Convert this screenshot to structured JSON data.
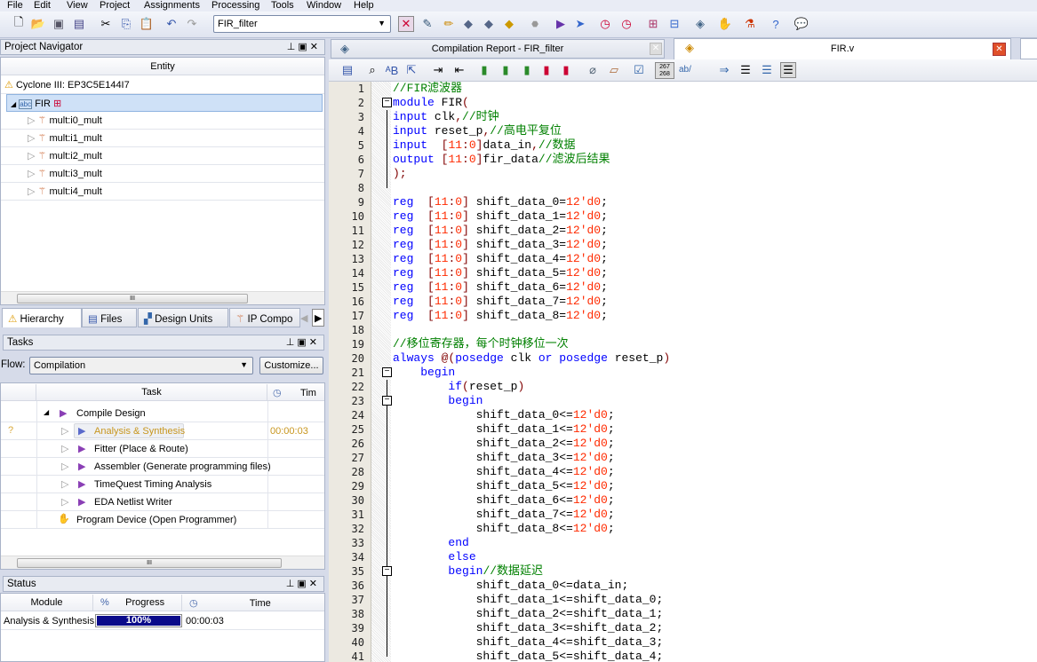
{
  "menu": [
    "File",
    "Edit",
    "View",
    "Project",
    "Assignments",
    "Processing",
    "Tools",
    "Window",
    "Help"
  ],
  "toolbar": {
    "project_combo": "FIR_filter"
  },
  "project_navigator": {
    "title": "Project Navigator",
    "column": "Entity",
    "device": "Cyclone III: EP3C5E144I7",
    "top_entity": "FIR",
    "children": [
      "mult:i0_mult",
      "mult:i1_mult",
      "mult:i2_mult",
      "mult:i3_mult",
      "mult:i4_mult"
    ],
    "tabs": [
      "Hierarchy",
      "Files",
      "Design Units",
      "IP Compo"
    ]
  },
  "tasks": {
    "title": "Tasks",
    "flow_label": "Flow:",
    "flow_value": "Compilation",
    "customize": "Customize...",
    "col_task": "Task",
    "col_time": "Tim",
    "items": [
      {
        "label": "Compile Design",
        "time": ""
      },
      {
        "label": "Analysis & Synthesis",
        "time": "00:00:03",
        "status": "?"
      },
      {
        "label": "Fitter (Place & Route)",
        "time": ""
      },
      {
        "label": "Assembler (Generate programming files)",
        "time": ""
      },
      {
        "label": "TimeQuest Timing Analysis",
        "time": ""
      },
      {
        "label": "EDA Netlist Writer",
        "time": ""
      },
      {
        "label": "Program Device (Open Programmer)",
        "time": ""
      }
    ]
  },
  "status": {
    "title": "Status",
    "col_module": "Module",
    "col_pct": "%",
    "col_progress": "Progress",
    "col_time": "Time",
    "row": {
      "module": "Analysis & Synthesis",
      "progress_text": "100%",
      "progress": 100,
      "time": "00:00:03"
    }
  },
  "editor": {
    "tabs": [
      "Compilation Report - FIR_filter",
      "FIR.v"
    ],
    "line_counter": [
      "267",
      "268"
    ],
    "toolbar_ab": "ab/",
    "lines": [
      [
        [
          "c",
          "//FIR滤波器"
        ]
      ],
      [
        [
          "k",
          "module"
        ],
        [
          "t",
          " FIR"
        ],
        [
          "p",
          "("
        ]
      ],
      [
        [
          "k",
          "input"
        ],
        [
          "t",
          " clk"
        ],
        [
          "p",
          ","
        ],
        [
          "c",
          "//时钟"
        ]
      ],
      [
        [
          "k",
          "input"
        ],
        [
          "t",
          " reset_p"
        ],
        [
          "p",
          ","
        ],
        [
          "c",
          "//高电平复位"
        ]
      ],
      [
        [
          "k",
          "input"
        ],
        [
          "t",
          "  "
        ],
        [
          "p",
          "["
        ],
        [
          "n",
          "11"
        ],
        [
          "p",
          ":"
        ],
        [
          "n",
          "0"
        ],
        [
          "p",
          "]"
        ],
        [
          "t",
          "data_in"
        ],
        [
          "p",
          ","
        ],
        [
          "c",
          "//数据"
        ]
      ],
      [
        [
          "k",
          "output"
        ],
        [
          "t",
          " "
        ],
        [
          "p",
          "["
        ],
        [
          "n",
          "11"
        ],
        [
          "p",
          ":"
        ],
        [
          "n",
          "0"
        ],
        [
          "p",
          "]"
        ],
        [
          "t",
          "fir_data"
        ],
        [
          "c",
          "//滤波后结果"
        ]
      ],
      [
        [
          "p",
          ");"
        ]
      ],
      [],
      [
        [
          "k",
          "reg"
        ],
        [
          "t",
          "  "
        ],
        [
          "p",
          "["
        ],
        [
          "n",
          "11"
        ],
        [
          "p",
          ":"
        ],
        [
          "n",
          "0"
        ],
        [
          "p",
          "]"
        ],
        [
          "t",
          " shift_data_0="
        ],
        [
          "n",
          "12'd0"
        ],
        [
          "t",
          ";"
        ]
      ],
      [
        [
          "k",
          "reg"
        ],
        [
          "t",
          "  "
        ],
        [
          "p",
          "["
        ],
        [
          "n",
          "11"
        ],
        [
          "p",
          ":"
        ],
        [
          "n",
          "0"
        ],
        [
          "p",
          "]"
        ],
        [
          "t",
          " shift_data_1="
        ],
        [
          "n",
          "12'd0"
        ],
        [
          "t",
          ";"
        ]
      ],
      [
        [
          "k",
          "reg"
        ],
        [
          "t",
          "  "
        ],
        [
          "p",
          "["
        ],
        [
          "n",
          "11"
        ],
        [
          "p",
          ":"
        ],
        [
          "n",
          "0"
        ],
        [
          "p",
          "]"
        ],
        [
          "t",
          " shift_data_2="
        ],
        [
          "n",
          "12'd0"
        ],
        [
          "t",
          ";"
        ]
      ],
      [
        [
          "k",
          "reg"
        ],
        [
          "t",
          "  "
        ],
        [
          "p",
          "["
        ],
        [
          "n",
          "11"
        ],
        [
          "p",
          ":"
        ],
        [
          "n",
          "0"
        ],
        [
          "p",
          "]"
        ],
        [
          "t",
          " shift_data_3="
        ],
        [
          "n",
          "12'd0"
        ],
        [
          "t",
          ";"
        ]
      ],
      [
        [
          "k",
          "reg"
        ],
        [
          "t",
          "  "
        ],
        [
          "p",
          "["
        ],
        [
          "n",
          "11"
        ],
        [
          "p",
          ":"
        ],
        [
          "n",
          "0"
        ],
        [
          "p",
          "]"
        ],
        [
          "t",
          " shift_data_4="
        ],
        [
          "n",
          "12'd0"
        ],
        [
          "t",
          ";"
        ]
      ],
      [
        [
          "k",
          "reg"
        ],
        [
          "t",
          "  "
        ],
        [
          "p",
          "["
        ],
        [
          "n",
          "11"
        ],
        [
          "p",
          ":"
        ],
        [
          "n",
          "0"
        ],
        [
          "p",
          "]"
        ],
        [
          "t",
          " shift_data_5="
        ],
        [
          "n",
          "12'd0"
        ],
        [
          "t",
          ";"
        ]
      ],
      [
        [
          "k",
          "reg"
        ],
        [
          "t",
          "  "
        ],
        [
          "p",
          "["
        ],
        [
          "n",
          "11"
        ],
        [
          "p",
          ":"
        ],
        [
          "n",
          "0"
        ],
        [
          "p",
          "]"
        ],
        [
          "t",
          " shift_data_6="
        ],
        [
          "n",
          "12'd0"
        ],
        [
          "t",
          ";"
        ]
      ],
      [
        [
          "k",
          "reg"
        ],
        [
          "t",
          "  "
        ],
        [
          "p",
          "["
        ],
        [
          "n",
          "11"
        ],
        [
          "p",
          ":"
        ],
        [
          "n",
          "0"
        ],
        [
          "p",
          "]"
        ],
        [
          "t",
          " shift_data_7="
        ],
        [
          "n",
          "12'd0"
        ],
        [
          "t",
          ";"
        ]
      ],
      [
        [
          "k",
          "reg"
        ],
        [
          "t",
          "  "
        ],
        [
          "p",
          "["
        ],
        [
          "n",
          "11"
        ],
        [
          "p",
          ":"
        ],
        [
          "n",
          "0"
        ],
        [
          "p",
          "]"
        ],
        [
          "t",
          " shift_data_8="
        ],
        [
          "n",
          "12'd0"
        ],
        [
          "t",
          ";"
        ]
      ],
      [],
      [
        [
          "c",
          "//移位寄存器，每个时钟移位一次"
        ]
      ],
      [
        [
          "k",
          "always"
        ],
        [
          "t",
          " "
        ],
        [
          "p",
          "@("
        ],
        [
          "k",
          "posedge"
        ],
        [
          "t",
          " clk "
        ],
        [
          "k",
          "or"
        ],
        [
          "t",
          " "
        ],
        [
          "k",
          "posedge"
        ],
        [
          "t",
          " reset_p"
        ],
        [
          "p",
          ")"
        ]
      ],
      [
        [
          "t",
          "    "
        ],
        [
          "k",
          "begin"
        ]
      ],
      [
        [
          "t",
          "        "
        ],
        [
          "k",
          "if"
        ],
        [
          "p",
          "("
        ],
        [
          "t",
          "reset_p"
        ],
        [
          "p",
          ")"
        ]
      ],
      [
        [
          "t",
          "        "
        ],
        [
          "k",
          "begin"
        ]
      ],
      [
        [
          "t",
          "            shift_data_0<="
        ],
        [
          "n",
          "12'd0"
        ],
        [
          "t",
          ";"
        ]
      ],
      [
        [
          "t",
          "            shift_data_1<="
        ],
        [
          "n",
          "12'd0"
        ],
        [
          "t",
          ";"
        ]
      ],
      [
        [
          "t",
          "            shift_data_2<="
        ],
        [
          "n",
          "12'd0"
        ],
        [
          "t",
          ";"
        ]
      ],
      [
        [
          "t",
          "            shift_data_3<="
        ],
        [
          "n",
          "12'd0"
        ],
        [
          "t",
          ";"
        ]
      ],
      [
        [
          "t",
          "            shift_data_4<="
        ],
        [
          "n",
          "12'd0"
        ],
        [
          "t",
          ";"
        ]
      ],
      [
        [
          "t",
          "            shift_data_5<="
        ],
        [
          "n",
          "12'd0"
        ],
        [
          "t",
          ";"
        ]
      ],
      [
        [
          "t",
          "            shift_data_6<="
        ],
        [
          "n",
          "12'd0"
        ],
        [
          "t",
          ";"
        ]
      ],
      [
        [
          "t",
          "            shift_data_7<="
        ],
        [
          "n",
          "12'd0"
        ],
        [
          "t",
          ";"
        ]
      ],
      [
        [
          "t",
          "            shift_data_8<="
        ],
        [
          "n",
          "12'd0"
        ],
        [
          "t",
          ";"
        ]
      ],
      [
        [
          "t",
          "        "
        ],
        [
          "k",
          "end"
        ]
      ],
      [
        [
          "t",
          "        "
        ],
        [
          "k",
          "else"
        ]
      ],
      [
        [
          "t",
          "        "
        ],
        [
          "k",
          "begin"
        ],
        [
          "c",
          "//数据延迟"
        ]
      ],
      [
        [
          "t",
          "            shift_data_0<=data_in;"
        ]
      ],
      [
        [
          "t",
          "            shift_data_1<=shift_data_0;"
        ]
      ],
      [
        [
          "t",
          "            shift_data_2<=shift_data_1;"
        ]
      ],
      [
        [
          "t",
          "            shift_data_3<=shift_data_2;"
        ]
      ],
      [
        [
          "t",
          "            shift_data_4<=shift_data_3;"
        ]
      ],
      [
        [
          "t",
          "            shift_data_5<=shift_data_4;"
        ]
      ]
    ]
  }
}
